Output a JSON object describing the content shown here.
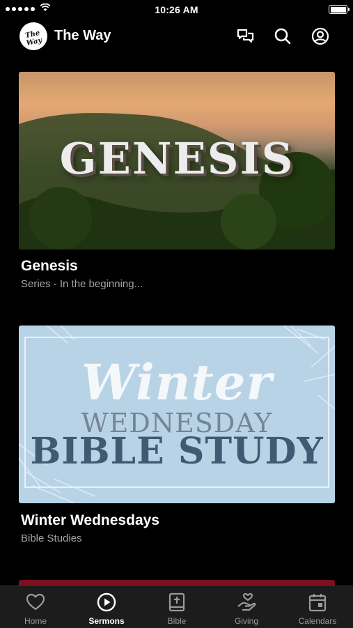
{
  "status_bar": {
    "time": "10:26 AM"
  },
  "header": {
    "logo_text": "The Way",
    "title": "The Way"
  },
  "cards": [
    {
      "title": "Genesis",
      "subtitle": "Series - In the beginning...",
      "art_text": "GENESIS"
    },
    {
      "title": "Winter Wednesdays",
      "subtitle": "Bible Studies",
      "art_line1": "Winter",
      "art_line2": "WEDNESDAY",
      "art_line3": "BIBLE STUDY"
    }
  ],
  "tabs": [
    {
      "label": "Home",
      "icon": "heart-icon"
    },
    {
      "label": "Sermons",
      "icon": "play-circle-icon",
      "active": true
    },
    {
      "label": "Bible",
      "icon": "bible-icon"
    },
    {
      "label": "Giving",
      "icon": "giving-hand-icon"
    },
    {
      "label": "Calendars",
      "icon": "calendar-icon"
    }
  ]
}
